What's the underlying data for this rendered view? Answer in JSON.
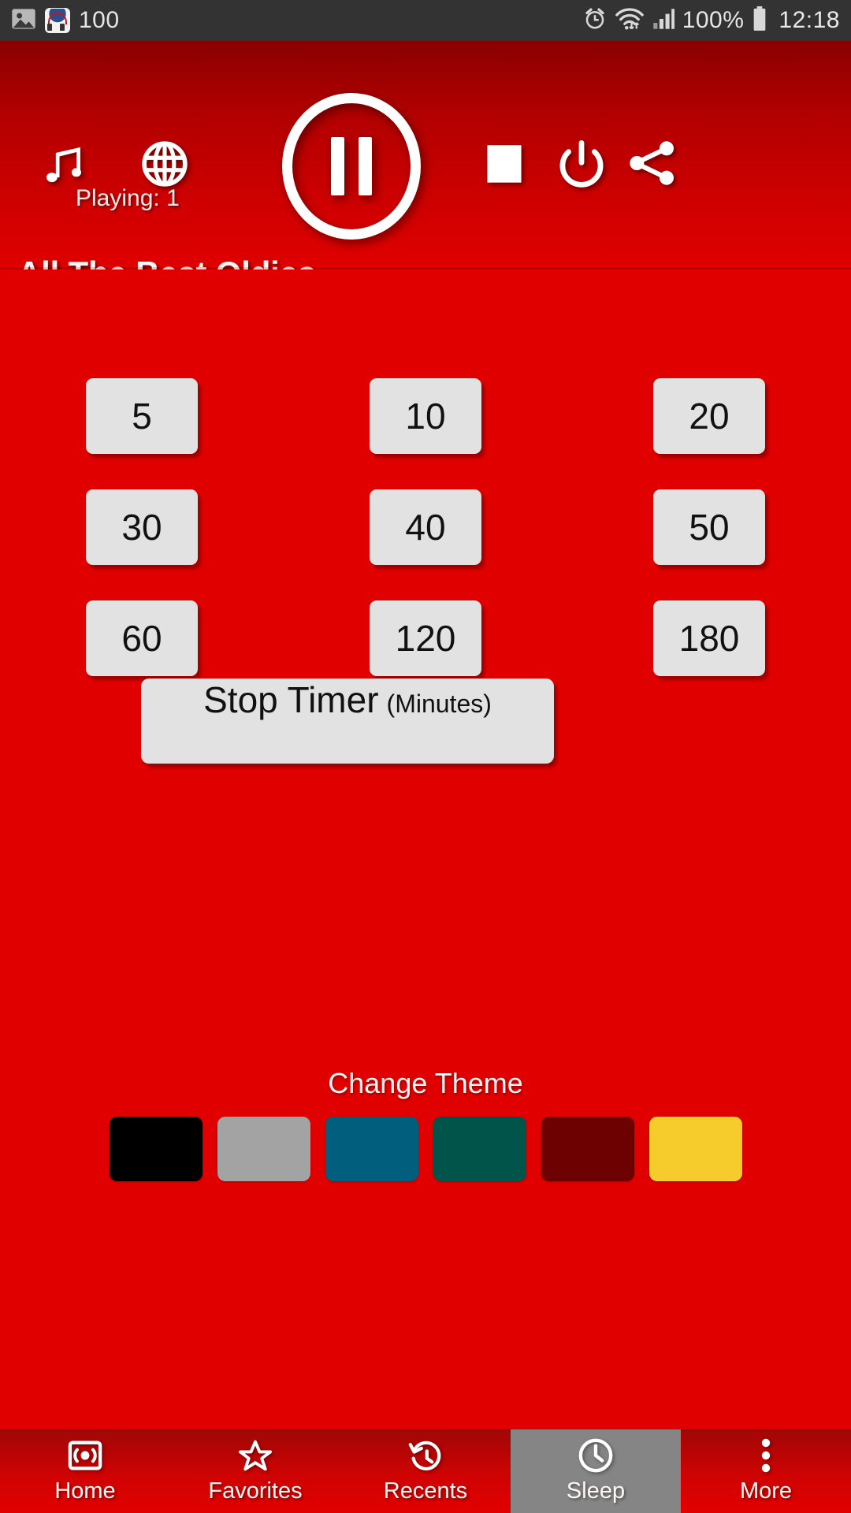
{
  "status_bar": {
    "left_icons": [
      "image-icon",
      "app-icon-nonstop-music"
    ],
    "notification_count": "100",
    "right_icons": [
      "alarm-icon",
      "wifi-icon",
      "signal-icon",
      "battery-icon"
    ],
    "battery_percent": "100%",
    "time": "12:18",
    "background": "#333333"
  },
  "header": {
    "music_icon": "music-note-icon",
    "globe_icon": "globe-icon",
    "play_pause_icon": "pause-icon",
    "stop_icon": "stop-icon",
    "power_icon": "power-icon",
    "share_icon": "share-icon",
    "playing_label": "Playing: 1",
    "station_name": "All The Best Oldies",
    "background": "#b00000"
  },
  "sleep_timer": {
    "options": [
      "5",
      "10",
      "20",
      "30",
      "40",
      "50",
      "60",
      "120",
      "180"
    ],
    "stop_button": {
      "main_label": "Stop Timer",
      "unit_label": "(Minutes)"
    }
  },
  "theme": {
    "label": "Change Theme",
    "swatches": [
      {
        "name": "black",
        "color": "#000000"
      },
      {
        "name": "grey",
        "color": "#a3a3a3"
      },
      {
        "name": "teal-blue",
        "color": "#015e7c"
      },
      {
        "name": "dark-green",
        "color": "#00544a"
      },
      {
        "name": "dark-red",
        "color": "#6d0000"
      },
      {
        "name": "yellow",
        "color": "#f5cc2b"
      }
    ]
  },
  "bottom_nav": {
    "items": [
      {
        "label": "Home",
        "icon": "radio-broadcast-icon",
        "selected": false
      },
      {
        "label": "Favorites",
        "icon": "star-icon",
        "selected": false
      },
      {
        "label": "Recents",
        "icon": "history-clock-icon",
        "selected": false
      },
      {
        "label": "Sleep",
        "icon": "clock-icon",
        "selected": true
      },
      {
        "label": "More",
        "icon": "overflow-dots-icon",
        "selected": false
      }
    ],
    "selected_background": "#858585"
  },
  "colors": {
    "app_background": "#e00000",
    "header_background": "#b00000",
    "button_face": "#e2e2e2"
  }
}
